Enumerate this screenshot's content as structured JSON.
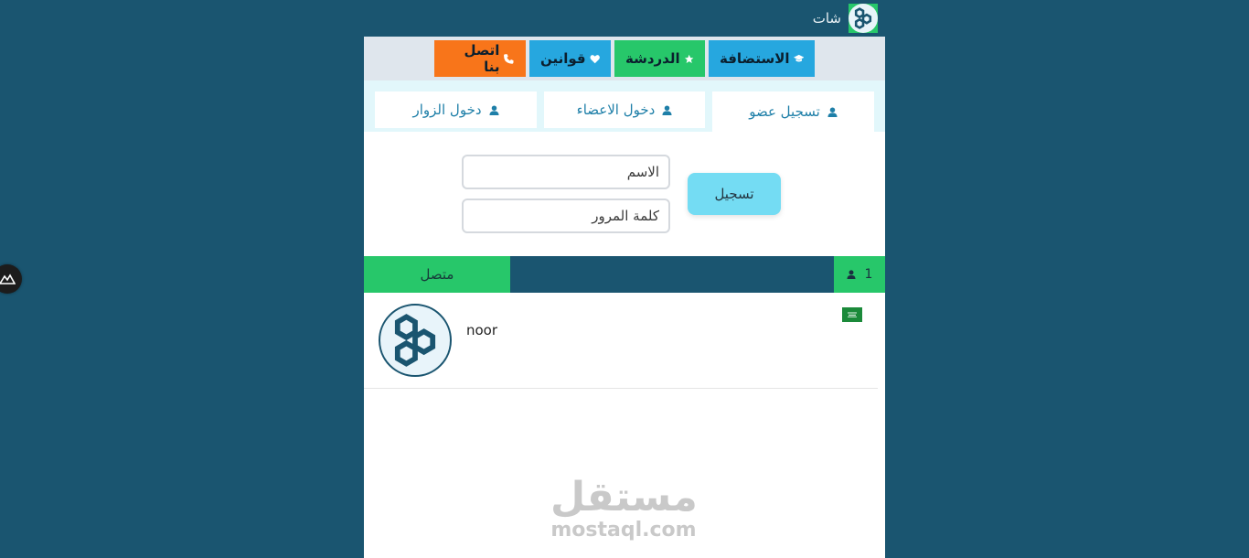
{
  "header": {
    "title": "شات",
    "refresh_icon": "refresh-icon",
    "logo_icon": "hexagons-logo-icon",
    "brand_color": "#1a5570"
  },
  "nav": {
    "items": [
      {
        "label": "الاستضافة",
        "icon": "graduation-cap-icon",
        "color": "#26a7df"
      },
      {
        "label": "الدردشة",
        "icon": "star-icon",
        "color": "#27c76a"
      },
      {
        "label": "قوانين",
        "icon": "heart-icon",
        "color": "#26a7df"
      },
      {
        "label": "اتصل بنا",
        "icon": "phone-icon",
        "color": "#f8751a"
      }
    ]
  },
  "tabs": [
    {
      "label": "تسجيل عضو",
      "active": true
    },
    {
      "label": "دخول الاعضاء",
      "active": false
    },
    {
      "label": "دخول الزوار",
      "active": false
    }
  ],
  "form": {
    "name_placeholder": "الاسم",
    "password_placeholder": "كلمة المرور",
    "submit_label": "تسجيل"
  },
  "status": {
    "online_label": "متصل",
    "online_count": "1"
  },
  "users": [
    {
      "name": "noor",
      "flag": "saudi-flag-icon"
    }
  ],
  "watermark": {
    "arabic": "مستقل",
    "latin": "mostaql.com"
  }
}
